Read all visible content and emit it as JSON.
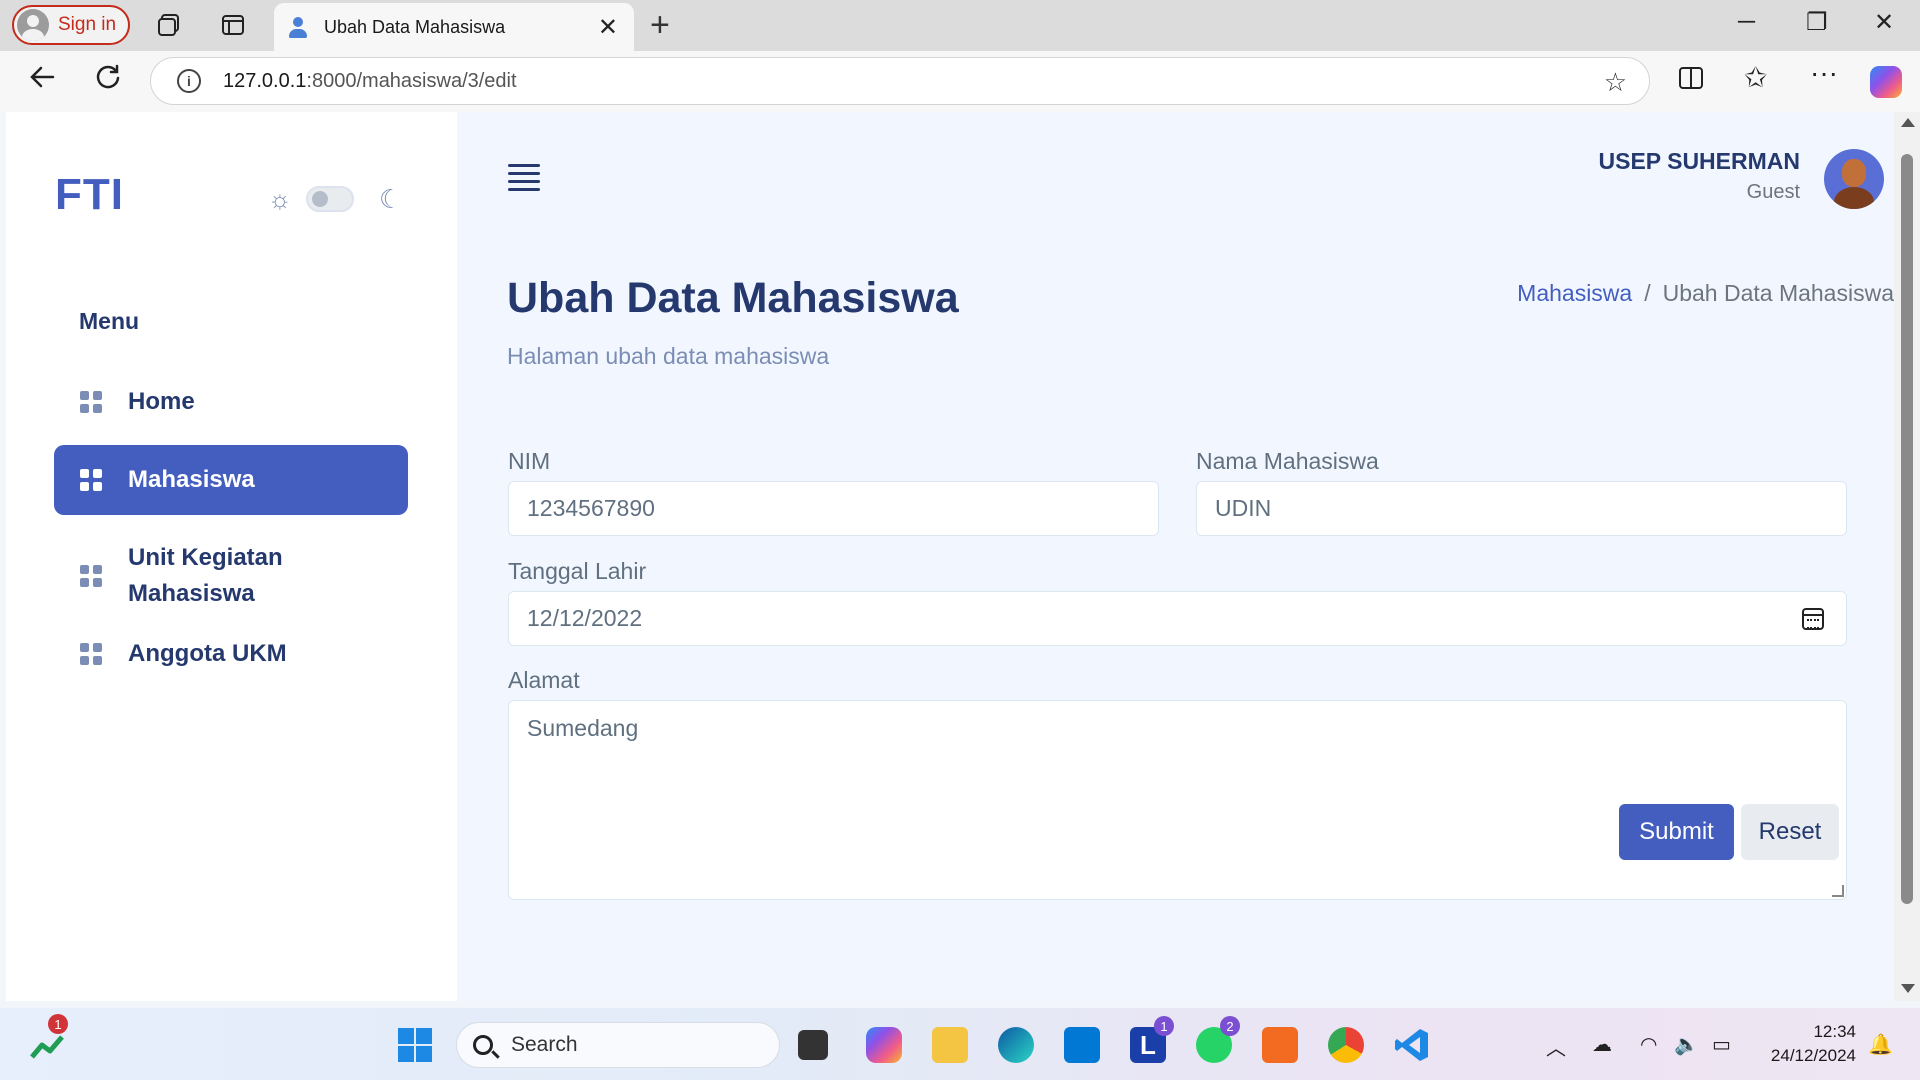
{
  "browser": {
    "sign_in": "Sign in",
    "tab_title": "Ubah Data Mahasiswa",
    "url_host": "127.0.0.1",
    "url_path": ":8000/mahasiswa/3/edit"
  },
  "sidebar": {
    "logo": "FTI",
    "menu_title": "Menu",
    "items": [
      {
        "label": "Home",
        "active": false
      },
      {
        "label": "Mahasiswa",
        "active": true
      },
      {
        "label": "Unit Kegiatan Mahasiswa",
        "active": false
      },
      {
        "label": "Anggota UKM",
        "active": false
      }
    ]
  },
  "header": {
    "user_name": "USEP SUHERMAN",
    "user_role": "Guest"
  },
  "page": {
    "title": "Ubah Data Mahasiswa",
    "subtitle": "Halaman ubah data mahasiswa",
    "breadcrumb": [
      "Mahasiswa",
      "Ubah Data Mahasiswa"
    ]
  },
  "form": {
    "nim_label": "NIM",
    "nim_value": "1234567890",
    "nama_label": "Nama Mahasiswa",
    "nama_value": "UDIN",
    "tanggal_label": "Tanggal Lahir",
    "tanggal_value": "12/12/2022",
    "alamat_label": "Alamat",
    "alamat_value": "Sumedang",
    "submit_label": "Submit",
    "reset_label": "Reset"
  },
  "taskbar": {
    "search_label": "Search",
    "time": "12:34",
    "date": "24/12/2024",
    "badges": [
      "1",
      "1",
      "2"
    ]
  },
  "colors": {
    "primary": "#435ebe",
    "text_dark": "#25396f",
    "muted": "#7c8db5"
  }
}
